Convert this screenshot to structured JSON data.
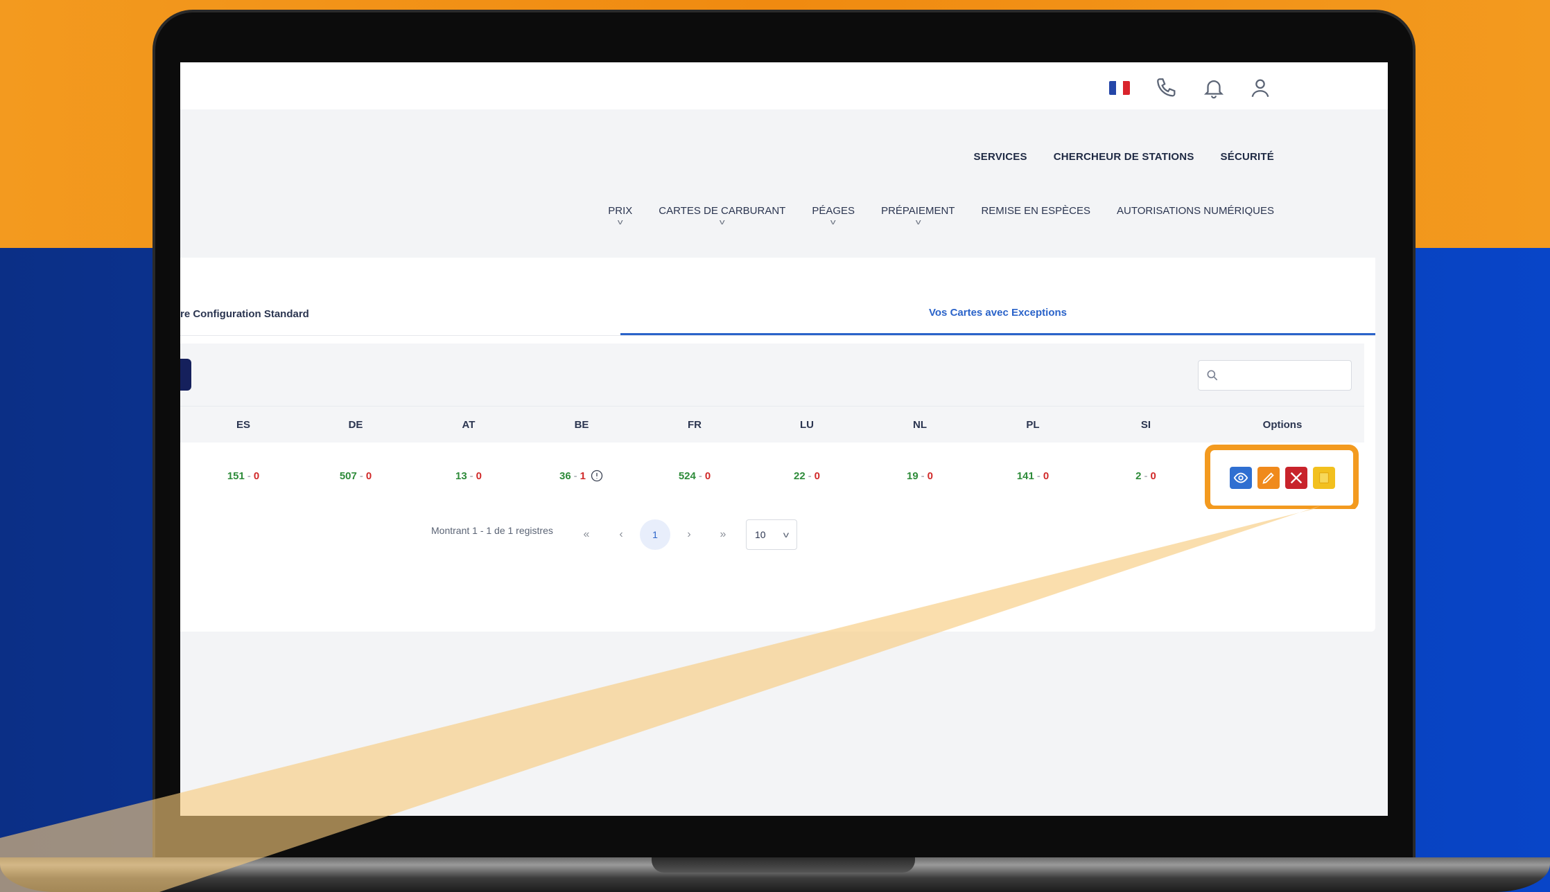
{
  "colors": {
    "accent_orange": "#f39a1f",
    "link_blue": "#2a63c9",
    "positive_green": "#2e8b3a",
    "negative_red": "#d12a2a",
    "navy": "#15205c"
  },
  "topbar": {
    "flag_colors": [
      "#2446a8",
      "#ffffff",
      "#d9232b"
    ],
    "icons": {
      "phone": "phone-icon",
      "bell": "bell-icon",
      "user": "user-icon"
    }
  },
  "nav_main": [
    "SERVICES",
    "CHERCHEUR DE STATIONS",
    "SÉCURITÉ"
  ],
  "nav_sub": [
    {
      "label": "PRIX",
      "has_dropdown": true
    },
    {
      "label": "CARTES DE CARBURANT",
      "has_dropdown": true
    },
    {
      "label": "PÉAGES",
      "has_dropdown": true
    },
    {
      "label": "PRÉPAIEMENT",
      "has_dropdown": true
    },
    {
      "label": "REMISE EN ESPÈCES",
      "has_dropdown": false
    },
    {
      "label": "AUTORISATIONS NUMÉRIQUES",
      "has_dropdown": false
    }
  ],
  "tabs": [
    "re Configuration Standard",
    "Vos Cartes avec Exceptions"
  ],
  "search": {
    "placeholder": "",
    "value": ""
  },
  "table": {
    "columns": [
      "ES",
      "DE",
      "AT",
      "BE",
      "FR",
      "LU",
      "NL",
      "PL",
      "SI",
      "Options"
    ],
    "row": [
      {
        "ok": "151",
        "sep": "-",
        "ko": "0"
      },
      {
        "ok": "507",
        "sep": "-",
        "ko": "0"
      },
      {
        "ok": "13",
        "sep": "-",
        "ko": "0"
      },
      {
        "ok": "36",
        "sep": "-",
        "ko": "1",
        "info": true
      },
      {
        "ok": "524",
        "sep": "-",
        "ko": "0"
      },
      {
        "ok": "22",
        "sep": "-",
        "ko": "0"
      },
      {
        "ok": "19",
        "sep": "-",
        "ko": "0"
      },
      {
        "ok": "141",
        "sep": "-",
        "ko": "0"
      },
      {
        "ok": "2",
        "sep": "-",
        "ko": "0"
      }
    ],
    "options": [
      {
        "icon": "eye-icon",
        "color": "#2f6fd1"
      },
      {
        "icon": "pencil-icon",
        "color": "#f08a1c"
      },
      {
        "icon": "close-icon",
        "color": "#c8232b"
      },
      {
        "icon": "note-icon",
        "color": "#f2c01e"
      }
    ]
  },
  "pagination": {
    "summary": "Montrant 1 - 1 de 1 registres",
    "first": "«",
    "prev": "‹",
    "current": "1",
    "next": "›",
    "last": "»",
    "page_size": "10"
  }
}
